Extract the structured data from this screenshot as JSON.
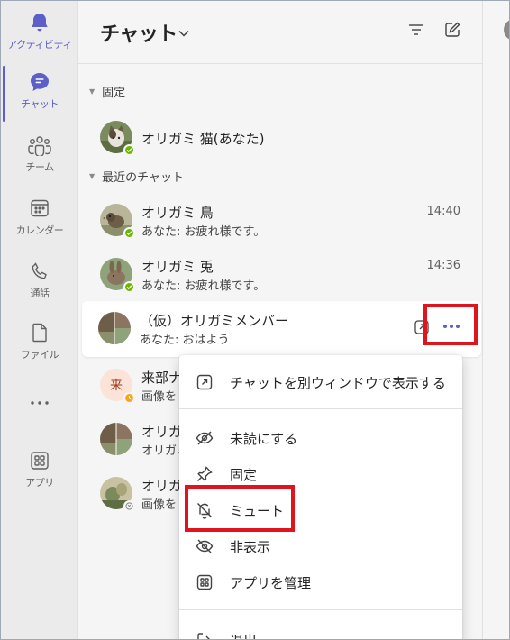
{
  "rail": {
    "items": [
      {
        "label": "アクティビティ",
        "icon": "bell-icon"
      },
      {
        "label": "チャット",
        "icon": "chat-icon"
      },
      {
        "label": "チーム",
        "icon": "teams-icon"
      },
      {
        "label": "カレンダー",
        "icon": "calendar-icon"
      },
      {
        "label": "通話",
        "icon": "phone-icon"
      },
      {
        "label": "ファイル",
        "icon": "file-icon"
      },
      {
        "label": "",
        "icon": "more-apps-icon"
      },
      {
        "label": "アプリ",
        "icon": "apps-icon"
      }
    ],
    "accent": "#5b5fc7"
  },
  "header": {
    "title": "チャット"
  },
  "sections": {
    "pinned": "固定",
    "recent": "最近のチャット"
  },
  "chats": {
    "pinned": [
      {
        "name": "オリガミ 猫(あなた)",
        "status": "available"
      }
    ],
    "recent": [
      {
        "name": "オリガミ 鳥",
        "preview": "あなた: お疲れ様です。",
        "time": "14:40",
        "status": "available"
      },
      {
        "name": "オリガミ 兎",
        "preview": "あなた: お疲れ様です。",
        "time": "14:36",
        "status": "available"
      },
      {
        "name": "（仮）オリガミメンバー",
        "preview": "あなた: おはよう",
        "time": ""
      },
      {
        "name": "来部ナ",
        "preview": "画像を",
        "avatar_text": "来",
        "status": "away"
      },
      {
        "name": "オリガ",
        "preview": "オリガミ"
      },
      {
        "name": "オリガ",
        "preview": "画像を",
        "status": "offline"
      }
    ]
  },
  "menu": {
    "items": [
      {
        "label": "チャットを別ウィンドウで表示する",
        "icon": "popout-icon"
      },
      {
        "label": "未読にする",
        "icon": "mark-unread-icon"
      },
      {
        "label": "固定",
        "icon": "pin-icon"
      },
      {
        "label": "ミュート",
        "icon": "mute-bell-icon"
      },
      {
        "label": "非表示",
        "icon": "hide-eye-icon"
      },
      {
        "label": "アプリを管理",
        "icon": "apps-icon"
      },
      {
        "label": "退出",
        "icon": "leave-icon"
      }
    ]
  },
  "colors": {
    "highlight": "#e0141e",
    "available": "#6bb700",
    "away": "#f8a51c",
    "offline": "#8a8a8a"
  }
}
